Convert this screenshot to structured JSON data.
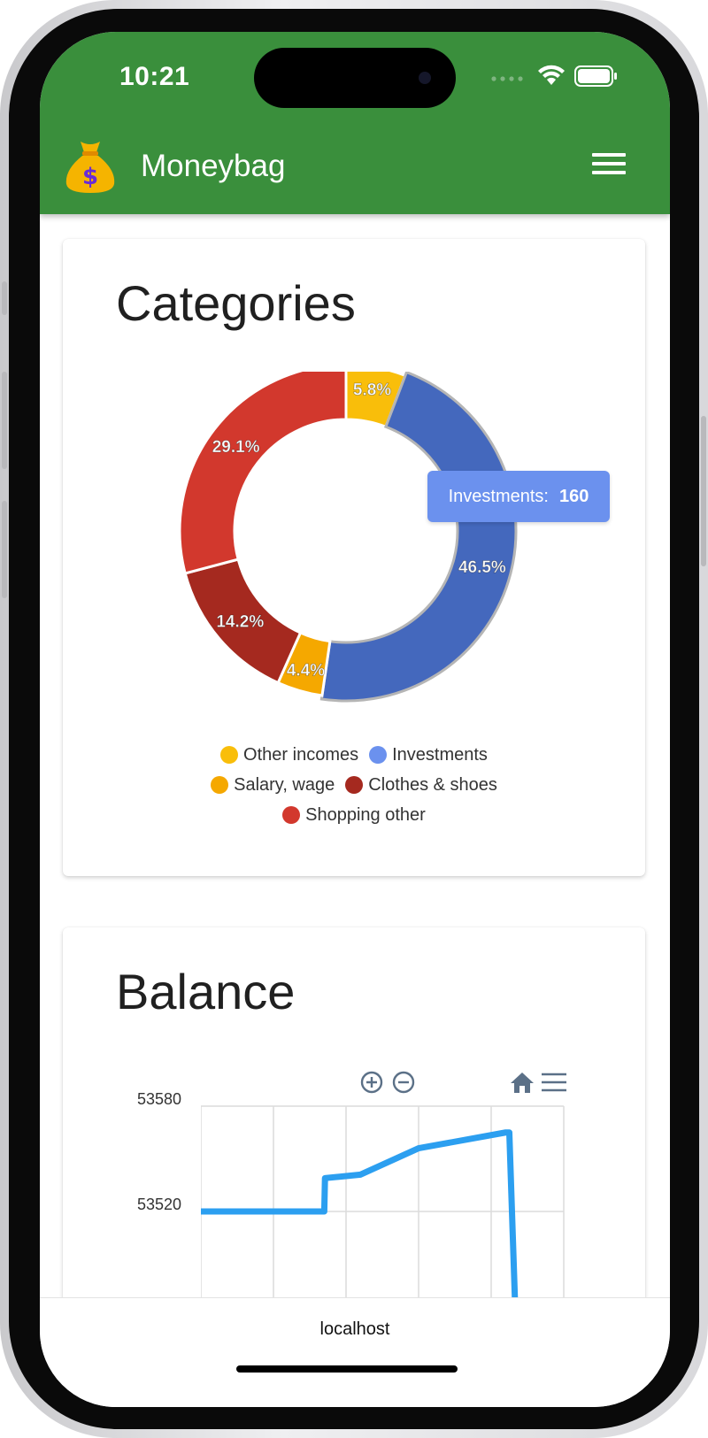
{
  "status_bar": {
    "time": "10:21"
  },
  "app_bar": {
    "title": "Moneybag"
  },
  "categories_card": {
    "title": "Categories",
    "tooltip": {
      "label": "Investments:",
      "value": "160"
    }
  },
  "balance_card": {
    "title": "Balance"
  },
  "browser": {
    "url": "localhost"
  },
  "chart_data": [
    {
      "type": "pie",
      "title": "Categories",
      "legend_position": "bottom",
      "series": [
        {
          "name": "Other incomes",
          "percent": 5.8,
          "label": "5.8%",
          "color": "#f9be0a"
        },
        {
          "name": "Investments",
          "percent": 46.5,
          "label": "46.5%",
          "color": "#4468bd",
          "value": 160
        },
        {
          "name": "Salary, wage",
          "percent": 4.4,
          "label": "4.4%",
          "color": "#f5a800"
        },
        {
          "name": "Clothes & shoes",
          "percent": 14.2,
          "label": "14.2%",
          "color": "#a5291f"
        },
        {
          "name": "Shopping other",
          "percent": 29.1,
          "label": "29.1%",
          "color": "#d2382d"
        }
      ],
      "legend_rows": [
        [
          0,
          1
        ],
        [
          2,
          3
        ],
        [
          4
        ]
      ]
    },
    {
      "type": "line",
      "title": "Balance",
      "y_ticks": [
        "53580",
        "53520"
      ],
      "ylim": [
        53460,
        53580
      ],
      "grid": true,
      "color": "#2c9ff0",
      "x": [
        0,
        1,
        1.7,
        1.71,
        2.2,
        3.0,
        4.2,
        4.25,
        4.4
      ],
      "y": [
        53520,
        53520,
        53520,
        53539,
        53541,
        53556,
        53565,
        53565,
        53380
      ],
      "xlim": [
        0,
        5
      ]
    }
  ]
}
